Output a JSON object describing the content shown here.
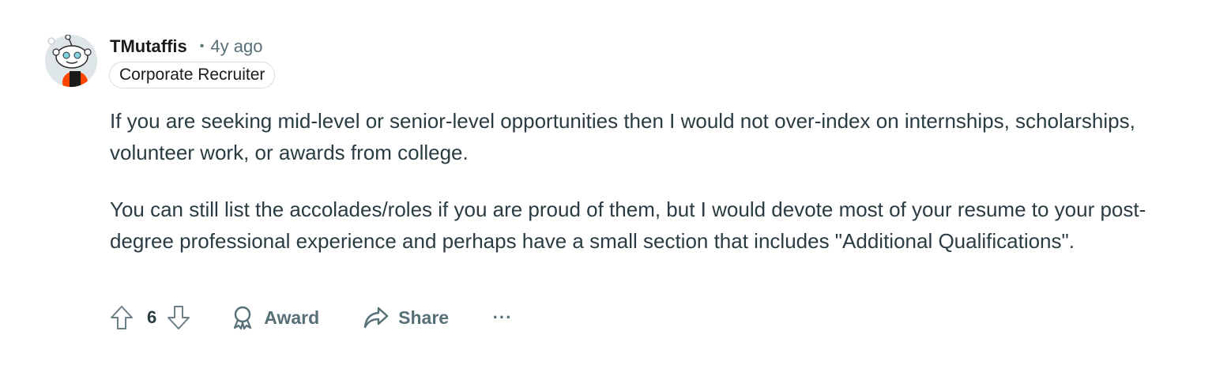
{
  "comment": {
    "username": "TMutaffis",
    "separator": "•",
    "timestamp": "4y ago",
    "flair": "Corporate Recruiter",
    "paragraphs": [
      "If you are seeking mid-level or senior-level opportunities then I would not over-index on internships, scholarships, volunteer work, or awards from college.",
      "You can still list the accolades/roles if you are proud of them, but I would devote most of your resume to your post-degree professional experience and perhaps have a small section that includes \"Additional Qualifications\"."
    ]
  },
  "actions": {
    "upvote_icon": "arrow-up-outline-icon",
    "score": "6",
    "downvote_icon": "arrow-down-outline-icon",
    "award_icon": "award-ribbon-icon",
    "award_label": "Award",
    "share_icon": "share-arrow-icon",
    "share_label": "Share",
    "more_label": "···"
  },
  "colors": {
    "text_primary": "#1c1c1c",
    "text_body": "#2a3c42",
    "text_secondary": "#576f76",
    "flair_border": "#d6dde0",
    "avatar_bg": "#e9eef0",
    "avatar_accent": "#ff4500"
  }
}
